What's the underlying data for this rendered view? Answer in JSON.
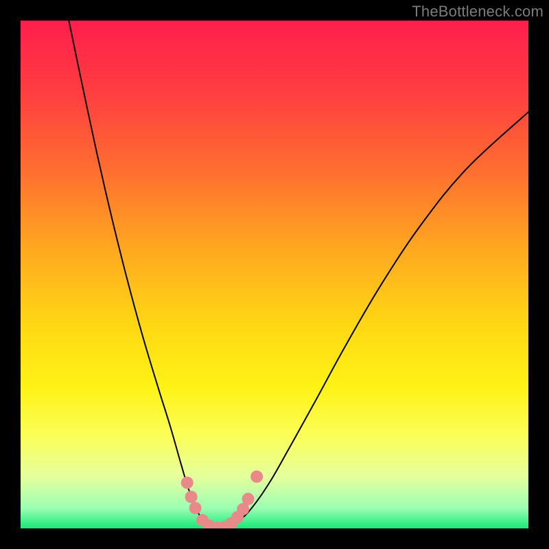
{
  "watermark": "TheBottleneck.com",
  "chart_data": {
    "type": "line",
    "title": "",
    "xlabel": "",
    "ylabel": "",
    "xlim": [
      0,
      100
    ],
    "ylim": [
      0,
      100
    ],
    "grid": false,
    "legend": false,
    "background_gradient_stops": [
      {
        "offset": 0.0,
        "color": "#ff1e4c"
      },
      {
        "offset": 0.15,
        "color": "#ff4040"
      },
      {
        "offset": 0.3,
        "color": "#ff7030"
      },
      {
        "offset": 0.45,
        "color": "#ffa81f"
      },
      {
        "offset": 0.6,
        "color": "#ffd814"
      },
      {
        "offset": 0.72,
        "color": "#fff215"
      },
      {
        "offset": 0.82,
        "color": "#fbff5a"
      },
      {
        "offset": 0.9,
        "color": "#e4ff9e"
      },
      {
        "offset": 0.96,
        "color": "#9cffb3"
      },
      {
        "offset": 1.0,
        "color": "#17e877"
      }
    ],
    "series": [
      {
        "name": "left-branch",
        "color": "#000000",
        "points": [
          {
            "x": 9.5,
            "y": 100.0
          },
          {
            "x": 12.0,
            "y": 88.0
          },
          {
            "x": 15.0,
            "y": 74.0
          },
          {
            "x": 18.0,
            "y": 61.0
          },
          {
            "x": 21.0,
            "y": 49.0
          },
          {
            "x": 24.0,
            "y": 38.0
          },
          {
            "x": 27.0,
            "y": 28.0
          },
          {
            "x": 29.5,
            "y": 20.0
          },
          {
            "x": 31.5,
            "y": 13.0
          },
          {
            "x": 33.0,
            "y": 8.0
          },
          {
            "x": 34.5,
            "y": 4.0
          },
          {
            "x": 36.0,
            "y": 1.5
          },
          {
            "x": 37.5,
            "y": 0.3
          },
          {
            "x": 39.0,
            "y": 0.0
          }
        ]
      },
      {
        "name": "right-branch",
        "color": "#000000",
        "points": [
          {
            "x": 39.0,
            "y": 0.0
          },
          {
            "x": 41.0,
            "y": 0.3
          },
          {
            "x": 43.0,
            "y": 1.5
          },
          {
            "x": 45.5,
            "y": 4.0
          },
          {
            "x": 49.0,
            "y": 9.0
          },
          {
            "x": 53.0,
            "y": 16.0
          },
          {
            "x": 58.0,
            "y": 25.0
          },
          {
            "x": 64.0,
            "y": 36.0
          },
          {
            "x": 71.0,
            "y": 48.0
          },
          {
            "x": 79.0,
            "y": 60.0
          },
          {
            "x": 88.0,
            "y": 71.0
          },
          {
            "x": 100.0,
            "y": 82.0
          }
        ]
      }
    ],
    "markers": {
      "name": "bottom-dots",
      "color": "#e98a8a",
      "radius": 9,
      "points": [
        {
          "x": 32.8,
          "y": 9.0
        },
        {
          "x": 33.6,
          "y": 6.2
        },
        {
          "x": 34.4,
          "y": 4.0
        },
        {
          "x": 35.8,
          "y": 1.6
        },
        {
          "x": 37.2,
          "y": 0.5
        },
        {
          "x": 38.8,
          "y": 0.1
        },
        {
          "x": 40.2,
          "y": 0.3
        },
        {
          "x": 41.5,
          "y": 1.0
        },
        {
          "x": 42.7,
          "y": 2.2
        },
        {
          "x": 43.8,
          "y": 3.8
        },
        {
          "x": 44.8,
          "y": 5.8
        },
        {
          "x": 46.5,
          "y": 10.2
        }
      ]
    }
  }
}
